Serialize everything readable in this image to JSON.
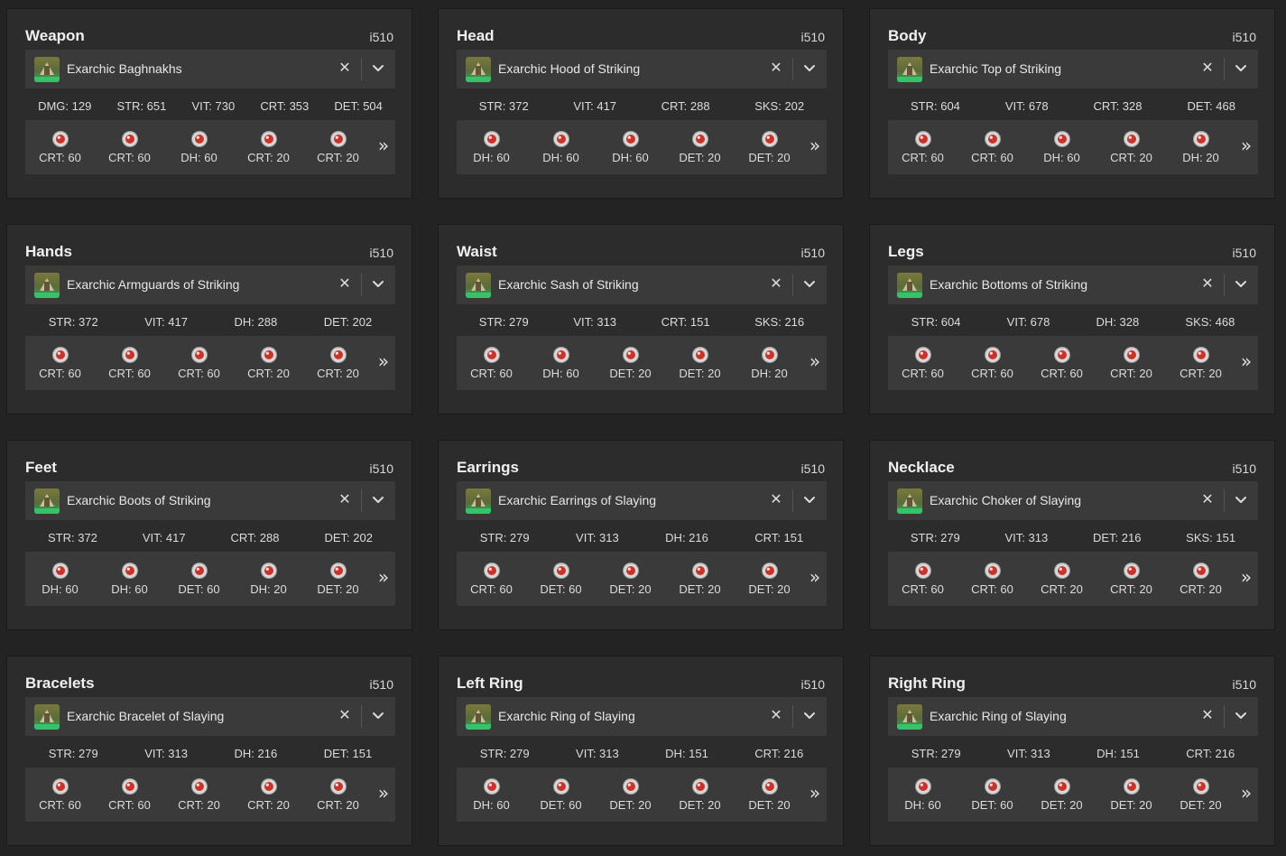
{
  "colors": {
    "background": "#232323",
    "card": "#2c2c2c",
    "field": "#3a3a3a",
    "text": "#e6e6e6",
    "materia_red": "#c8342c",
    "materia_silver": "#d8d8d8",
    "icon_green": "#2fa85a"
  },
  "icons": {
    "clear": "close-icon",
    "dropdown": "chevron-down-icon",
    "more": "double-chevron-right-icon",
    "materia": "materia-icon"
  },
  "clear_glyph": "✕",
  "more_glyph": "»",
  "slots": [
    {
      "title": "Weapon",
      "ilvl": "i510",
      "item": "Exarchic Baghnakhs",
      "stats": [
        "DMG: 129",
        "STR: 651",
        "VIT: 730",
        "CRT: 353",
        "DET: 504"
      ],
      "materia": [
        "CRT: 60",
        "CRT: 60",
        "DH: 60",
        "CRT: 20",
        "CRT: 20"
      ]
    },
    {
      "title": "Head",
      "ilvl": "i510",
      "item": "Exarchic Hood of Striking",
      "stats": [
        "STR: 372",
        "VIT: 417",
        "CRT: 288",
        "SKS: 202"
      ],
      "materia": [
        "DH: 60",
        "DH: 60",
        "DH: 60",
        "DET: 20",
        "DET: 20"
      ]
    },
    {
      "title": "Body",
      "ilvl": "i510",
      "item": "Exarchic Top of Striking",
      "stats": [
        "STR: 604",
        "VIT: 678",
        "CRT: 328",
        "DET: 468"
      ],
      "materia": [
        "CRT: 60",
        "CRT: 60",
        "DH: 60",
        "CRT: 20",
        "DH: 20"
      ]
    },
    {
      "title": "Hands",
      "ilvl": "i510",
      "item": "Exarchic Armguards of Striking",
      "stats": [
        "STR: 372",
        "VIT: 417",
        "DH: 288",
        "DET: 202"
      ],
      "materia": [
        "CRT: 60",
        "CRT: 60",
        "CRT: 60",
        "CRT: 20",
        "CRT: 20"
      ]
    },
    {
      "title": "Waist",
      "ilvl": "i510",
      "item": "Exarchic Sash of Striking",
      "stats": [
        "STR: 279",
        "VIT: 313",
        "CRT: 151",
        "SKS: 216"
      ],
      "materia": [
        "CRT: 60",
        "DH: 60",
        "DET: 20",
        "DET: 20",
        "DH: 20"
      ]
    },
    {
      "title": "Legs",
      "ilvl": "i510",
      "item": "Exarchic Bottoms of Striking",
      "stats": [
        "STR: 604",
        "VIT: 678",
        "DH: 328",
        "SKS: 468"
      ],
      "materia": [
        "CRT: 60",
        "CRT: 60",
        "CRT: 60",
        "CRT: 20",
        "CRT: 20"
      ]
    },
    {
      "title": "Feet",
      "ilvl": "i510",
      "item": "Exarchic Boots of Striking",
      "stats": [
        "STR: 372",
        "VIT: 417",
        "CRT: 288",
        "DET: 202"
      ],
      "materia": [
        "DH: 60",
        "DH: 60",
        "DET: 60",
        "DH: 20",
        "DET: 20"
      ]
    },
    {
      "title": "Earrings",
      "ilvl": "i510",
      "item": "Exarchic Earrings of Slaying",
      "stats": [
        "STR: 279",
        "VIT: 313",
        "DH: 216",
        "CRT: 151"
      ],
      "materia": [
        "CRT: 60",
        "DET: 60",
        "DET: 20",
        "DET: 20",
        "DET: 20"
      ]
    },
    {
      "title": "Necklace",
      "ilvl": "i510",
      "item": "Exarchic Choker of Slaying",
      "stats": [
        "STR: 279",
        "VIT: 313",
        "DET: 216",
        "SKS: 151"
      ],
      "materia": [
        "CRT: 60",
        "CRT: 60",
        "CRT: 20",
        "CRT: 20",
        "CRT: 20"
      ]
    },
    {
      "title": "Bracelets",
      "ilvl": "i510",
      "item": "Exarchic Bracelet of Slaying",
      "stats": [
        "STR: 279",
        "VIT: 313",
        "DH: 216",
        "DET: 151"
      ],
      "materia": [
        "CRT: 60",
        "CRT: 60",
        "CRT: 20",
        "CRT: 20",
        "CRT: 20"
      ]
    },
    {
      "title": "Left Ring",
      "ilvl": "i510",
      "item": "Exarchic Ring of Slaying",
      "stats": [
        "STR: 279",
        "VIT: 313",
        "DH: 151",
        "CRT: 216"
      ],
      "materia": [
        "DH: 60",
        "DET: 60",
        "DET: 20",
        "DET: 20",
        "DET: 20"
      ]
    },
    {
      "title": "Right Ring",
      "ilvl": "i510",
      "item": "Exarchic Ring of Slaying",
      "stats": [
        "STR: 279",
        "VIT: 313",
        "DH: 151",
        "CRT: 216"
      ],
      "materia": [
        "DH: 60",
        "DET: 60",
        "DET: 20",
        "DET: 20",
        "DET: 20"
      ]
    }
  ]
}
